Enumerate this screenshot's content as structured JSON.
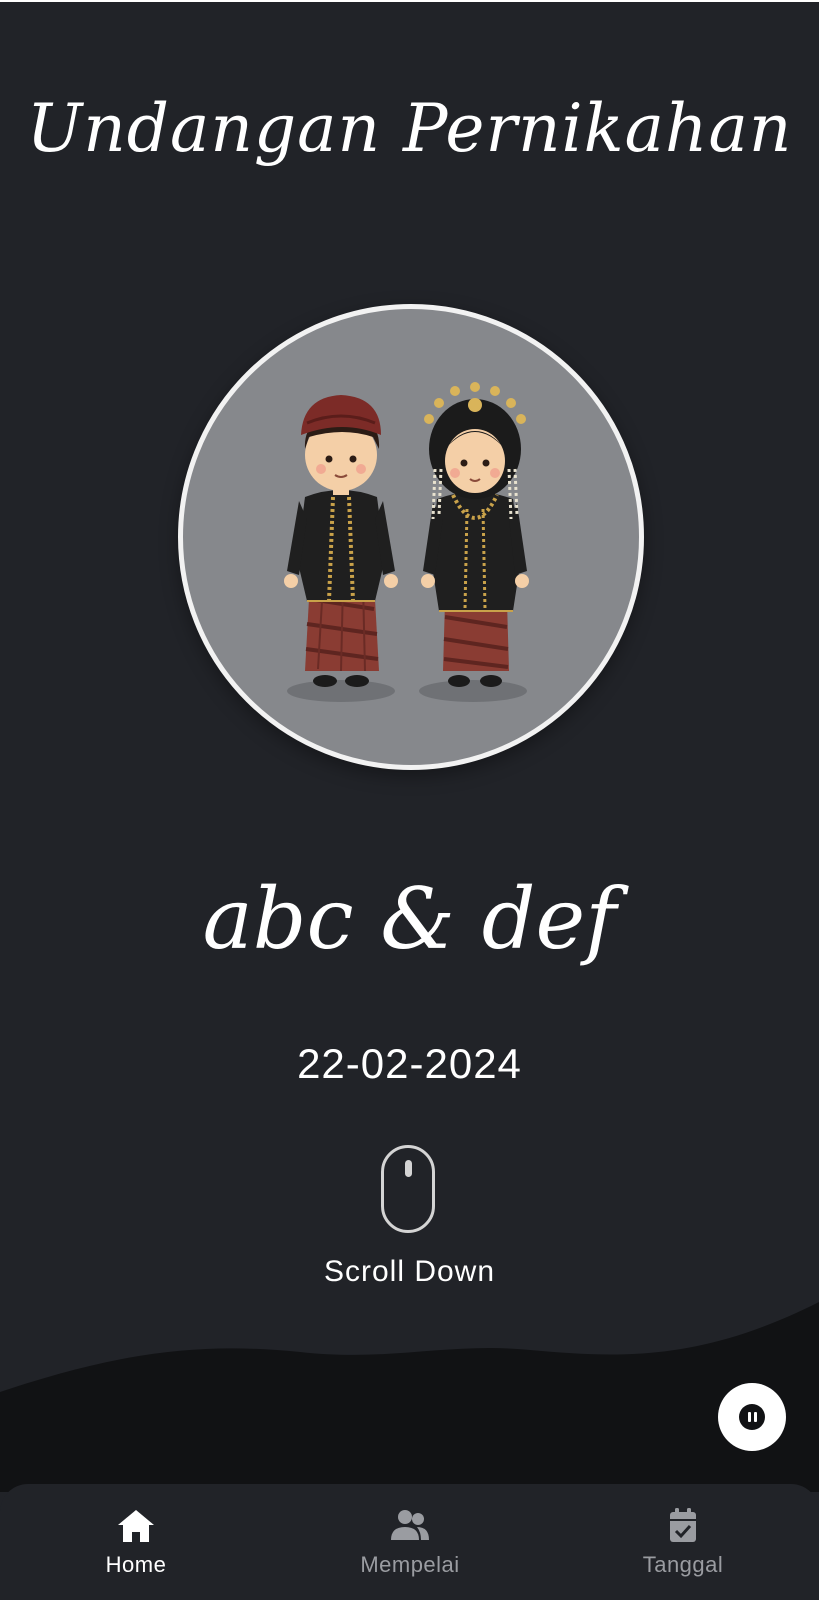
{
  "header": {
    "title": "Undangan Pernikahan"
  },
  "hero": {
    "image": "couple-illustration",
    "couple_names": "abc & def",
    "date": "22-02-2024"
  },
  "scroll_hint": {
    "icon": "mouse-icon",
    "label": "Scroll Down"
  },
  "music": {
    "icon": "pause-icon",
    "state": "playing"
  },
  "bottom_nav": {
    "items": [
      {
        "label": "Home",
        "icon": "home-icon",
        "active": true
      },
      {
        "label": "Mempelai",
        "icon": "users-icon",
        "active": false
      },
      {
        "label": "Tanggal",
        "icon": "calendar-check-icon",
        "active": false
      }
    ]
  },
  "colors": {
    "background": "#212328",
    "wave": "#111214",
    "portrait_bg": "#86888c",
    "text": "#ffffff",
    "nav_inactive": "#9a9ca1"
  }
}
